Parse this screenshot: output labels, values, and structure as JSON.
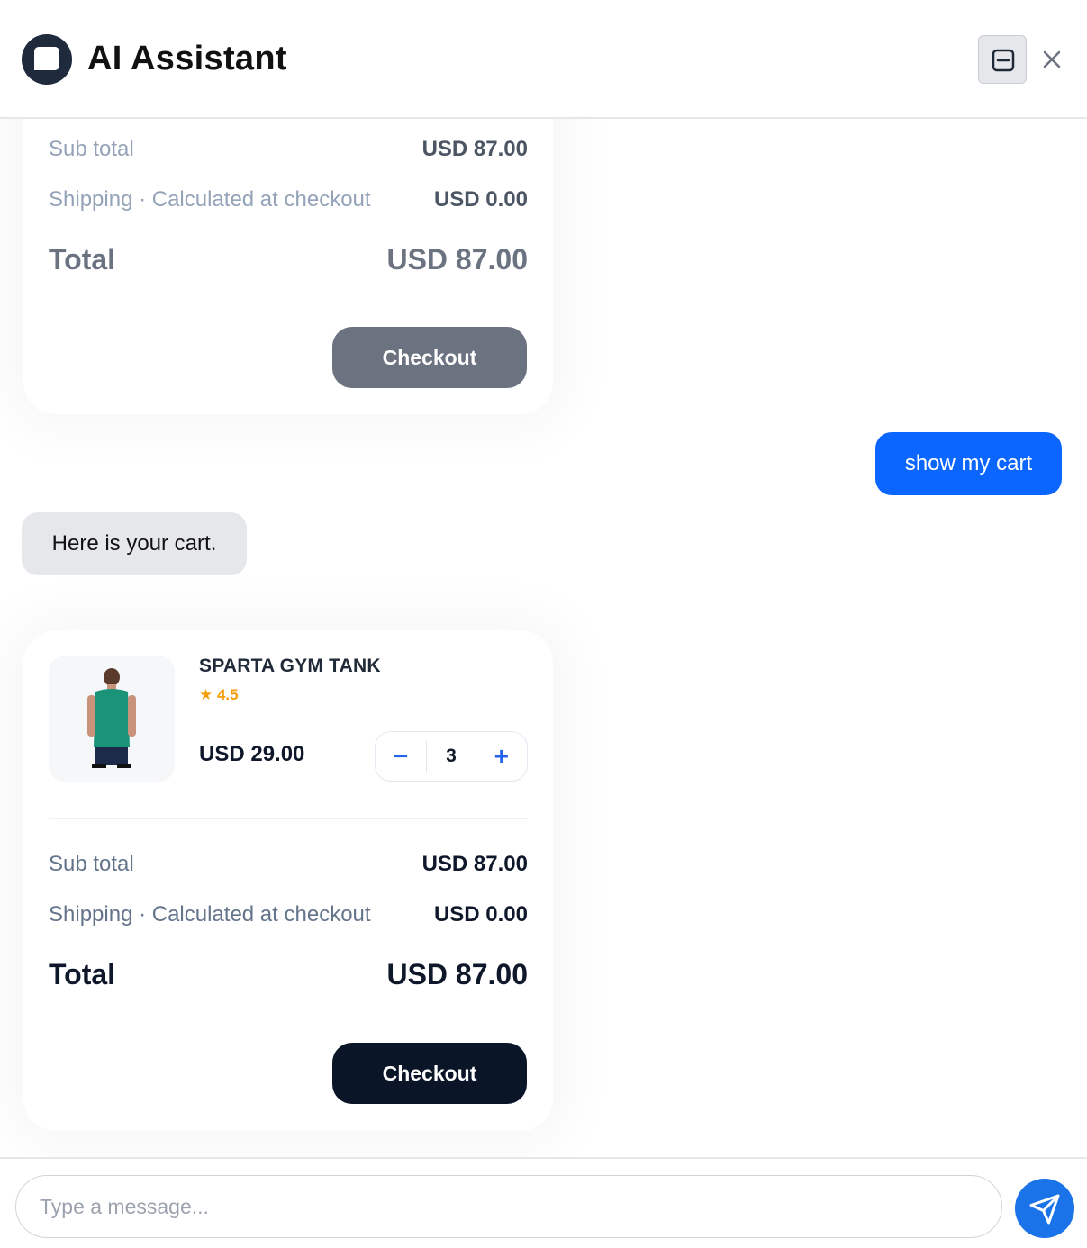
{
  "header": {
    "title": "AI Assistant",
    "logo_icon": "chat-bubble-icon",
    "minimize_icon": "minimize-icon",
    "close_icon": "close-icon"
  },
  "previous_cart": {
    "subtotal_label": "Sub total",
    "subtotal_value": "USD 87.00",
    "shipping_label": "Shipping · Calculated at checkout",
    "shipping_value": "USD 0.00",
    "total_label": "Total",
    "total_value": "USD 87.00",
    "checkout_label": "Checkout"
  },
  "messages": {
    "user": "show my cart",
    "assistant": "Here is your cart."
  },
  "cart": {
    "item": {
      "name": "SPARTA GYM TANK",
      "rating": "★ 4.5",
      "price": "USD 29.00",
      "quantity": "3",
      "decrement": "−",
      "increment": "+"
    },
    "subtotal_label": "Sub total",
    "subtotal_value": "USD 87.00",
    "shipping_label": "Shipping · Calculated at checkout",
    "shipping_value": "USD 0.00",
    "total_label": "Total",
    "total_value": "USD 87.00",
    "checkout_label": "Checkout"
  },
  "composer": {
    "placeholder": "Type a message...",
    "send_icon": "send-icon"
  },
  "colors": {
    "primary_blue": "#0b66ff",
    "send_blue": "#1a73e8",
    "checkout_dark": "#0b1528",
    "checkout_disabled": "#6b7280",
    "rating_star": "#f59e0b"
  }
}
